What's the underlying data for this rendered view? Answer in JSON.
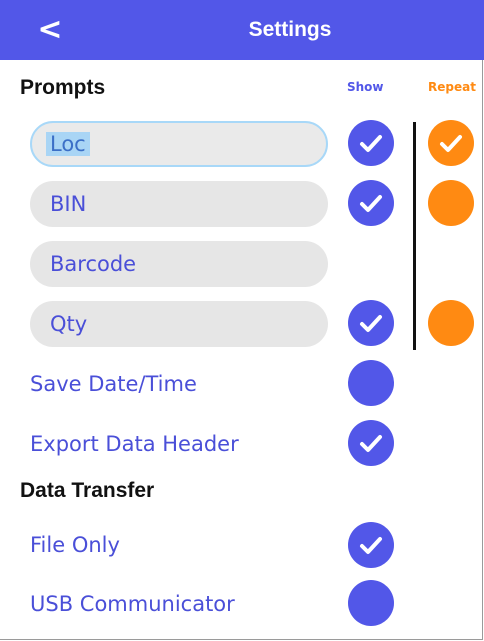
{
  "header": {
    "back_label": "<",
    "title": "Settings"
  },
  "prompts": {
    "section_title": "Prompts",
    "show_header": "Show",
    "repeat_header": "Repeat",
    "items": [
      {
        "label": "Loc",
        "show": true,
        "repeat": true,
        "repeat_visible": true
      },
      {
        "label": "BIN",
        "show": true,
        "repeat": false,
        "repeat_visible": true
      },
      {
        "label": "Barcode",
        "show": null,
        "repeat": null,
        "repeat_visible": false
      },
      {
        "label": "Qty",
        "show": true,
        "repeat": false,
        "repeat_visible": true
      }
    ]
  },
  "options": [
    {
      "label": "Save Date/Time",
      "checked": false
    },
    {
      "label": "Export Data Header",
      "checked": true
    }
  ],
  "data_transfer": {
    "section_title": "Data Transfer",
    "options": [
      {
        "label": "File Only",
        "checked": true
      },
      {
        "label": "USB Communicator",
        "checked": false
      }
    ]
  },
  "colors": {
    "accent": "#5257e8",
    "repeat": "#ff8a12",
    "field_bg": "#e6e6e6",
    "focus_border": "#a8d8f8"
  },
  "icons": {
    "back": "chevron-left-icon",
    "check": "checkmark-icon"
  }
}
